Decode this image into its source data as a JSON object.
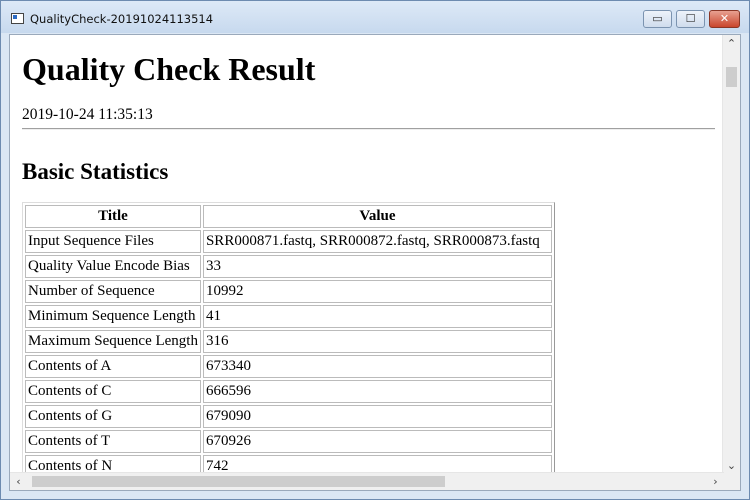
{
  "window": {
    "title": "QualityCheck-20191024113514",
    "controls": {
      "minimize": "▭",
      "maximize": "☐",
      "close": "✕"
    }
  },
  "page": {
    "heading": "Quality Check Result",
    "timestamp": "2019-10-24 11:35:13",
    "section_title": "Basic Statistics"
  },
  "table": {
    "headers": [
      "Title",
      "Value"
    ],
    "rows": [
      [
        "Input Sequence Files",
        "SRR000871.fastq, SRR000872.fastq, SRR000873.fastq"
      ],
      [
        "Quality Value Encode Bias",
        "33"
      ],
      [
        "Number of Sequence",
        "10992"
      ],
      [
        "Minimum Sequence Length",
        "41"
      ],
      [
        "Maximum Sequence Length",
        "316"
      ],
      [
        "Contents of A",
        "673340"
      ],
      [
        "Contents of C",
        "666596"
      ],
      [
        "Contents of G",
        "679090"
      ],
      [
        "Contents of T",
        "670926"
      ],
      [
        "Contents of N",
        "742"
      ]
    ]
  },
  "scrollbars": {
    "up": "⌃",
    "down": "⌄",
    "left": "‹",
    "right": "›"
  },
  "icons": [
    "app-icon",
    "minimize-icon",
    "maximize-icon",
    "close-icon",
    "scroll-up-icon",
    "scroll-down-icon",
    "scroll-left-icon",
    "scroll-right-icon"
  ]
}
